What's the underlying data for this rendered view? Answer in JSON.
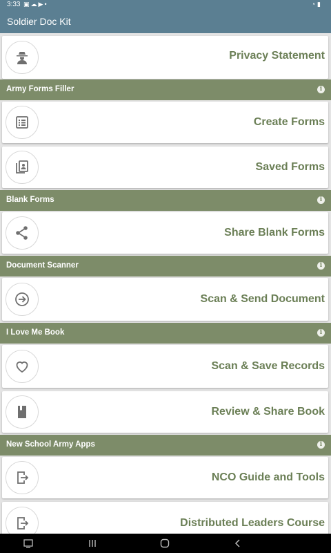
{
  "status_bar": {
    "time": "3:33",
    "left_icons": [
      "image-icon",
      "cloud-icon",
      "youtube-icon",
      "dot-icon"
    ],
    "right_icons": [
      "wifi-icon",
      "battery-icon"
    ]
  },
  "app_bar": {
    "title": "Soldier Doc Kit"
  },
  "privacy": {
    "label": "Privacy Statement",
    "icon": "spy-icon"
  },
  "sections": {
    "army_forms": {
      "title": "Army Forms Filler"
    },
    "blank_forms": {
      "title": "Blank Forms"
    },
    "scanner": {
      "title": "Document Scanner"
    },
    "love_me": {
      "title": "I Love Me Book"
    },
    "apps": {
      "title": "New School Army Apps"
    }
  },
  "items": {
    "create_forms": {
      "label": "Create Forms",
      "icon": "list-icon"
    },
    "saved_forms": {
      "label": "Saved Forms",
      "icon": "saved-doc-icon"
    },
    "share_blank": {
      "label": "Share Blank Forms",
      "icon": "share-icon"
    },
    "scan_send": {
      "label": "Scan & Send Document",
      "icon": "arrow-circle-icon"
    },
    "scan_save": {
      "label": "Scan & Save Records",
      "icon": "heart-icon"
    },
    "review_share": {
      "label": "Review & Share Book",
      "icon": "book-icon"
    },
    "nco_guide": {
      "label": "NCO Guide and Tools",
      "icon": "exit-app-icon"
    },
    "dlc": {
      "label": "Distributed Leaders Course",
      "icon": "exit-app-icon"
    }
  },
  "nav": [
    "screenshot-icon",
    "recents-icon",
    "home-icon",
    "back-icon"
  ],
  "colors": {
    "app_bar": "#5b7f92",
    "section": "#7d8c69",
    "label": "#6b7f56"
  }
}
